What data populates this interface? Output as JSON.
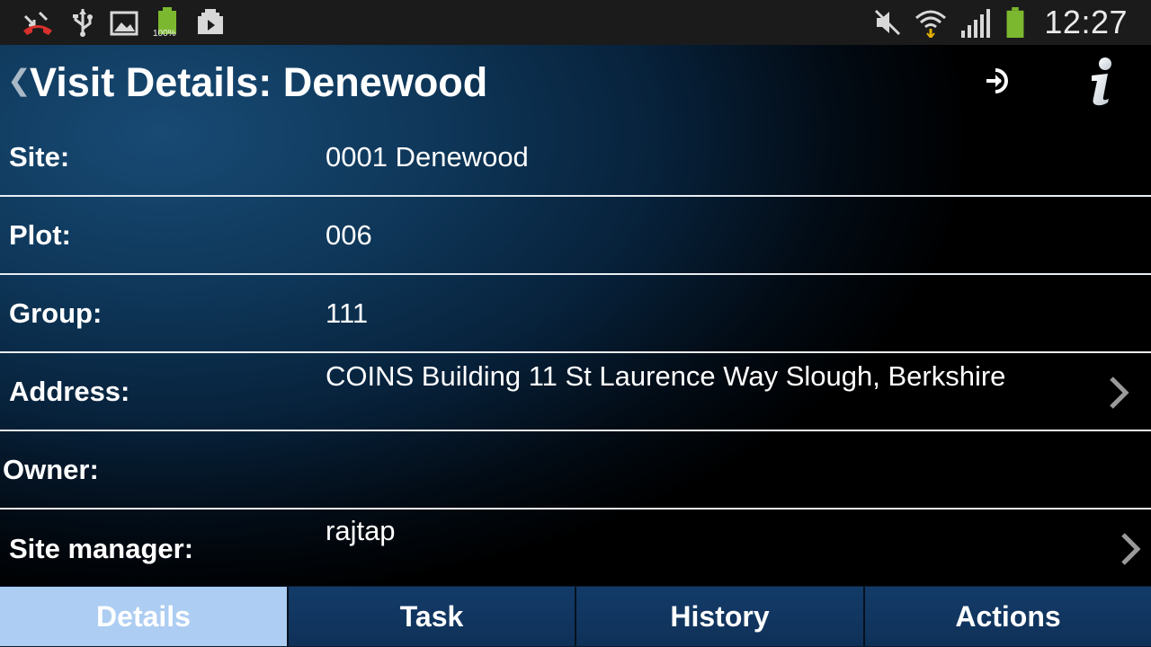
{
  "status_bar": {
    "time": "12:27",
    "battery_percent_label": "100%",
    "left_icons": [
      "missed-call-icon",
      "usb-icon",
      "image-icon",
      "battery-full-icon",
      "media-upload-icon"
    ],
    "right_icons": [
      "mute-icon",
      "wifi-icon",
      "signal-icon",
      "battery-icon"
    ]
  },
  "header": {
    "title": "Visit Details: Denewood",
    "back_icon": "chevron-left-icon",
    "logout_icon": "logout-icon",
    "info_icon": "info-icon"
  },
  "details": {
    "rows": [
      {
        "label": "Site:",
        "value": "0001 Denewood",
        "has_chevron": false
      },
      {
        "label": "Plot:",
        "value": "006",
        "has_chevron": false
      },
      {
        "label": "Group:",
        "value": "111",
        "has_chevron": false
      },
      {
        "label": "Address:",
        "value": "COINS Building 11 St Laurence Way Slough, Berkshire",
        "has_chevron": true
      },
      {
        "label": "Owner:",
        "value": "",
        "has_chevron": false
      },
      {
        "label": "Site manager:",
        "value": "rajtap",
        "has_chevron": true
      }
    ]
  },
  "tabs": [
    {
      "label": "Details",
      "active": true
    },
    {
      "label": "Task",
      "active": false
    },
    {
      "label": "History",
      "active": false
    },
    {
      "label": "Actions",
      "active": false
    }
  ],
  "colors": {
    "tab_active": "#adcdf2",
    "tab_inactive": "#133b68",
    "battery_green": "#7cb82f",
    "missed_call_red": "#d8302c"
  }
}
